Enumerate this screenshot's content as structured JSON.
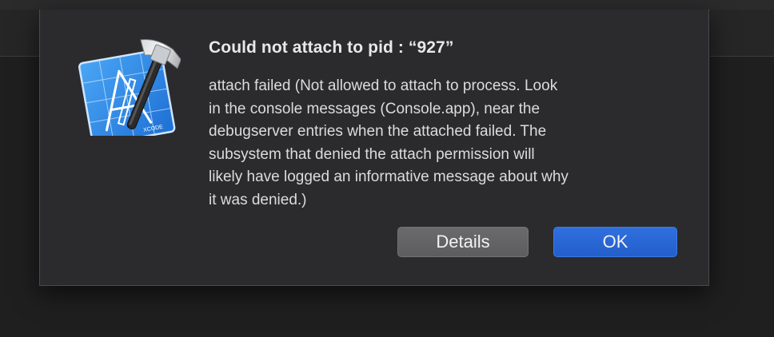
{
  "dialog": {
    "title": "Could not attach to pid : “927”",
    "message": "attach failed (Not allowed to attach to process.  Look\nin the console messages (Console.app), near the\ndebugserver entries when the attached failed.  The\nsubsystem that denied the attach permission will\nlikely have logged an informative message about why\nit was denied.)",
    "icon": "xcode-app-icon",
    "icon_text": "XCODE"
  },
  "buttons": {
    "details_label": "Details",
    "ok_label": "OK"
  },
  "colors": {
    "dialog_background": "#2b2b2d",
    "default_button": "#2a66d6",
    "secondary_button": "#636365"
  }
}
